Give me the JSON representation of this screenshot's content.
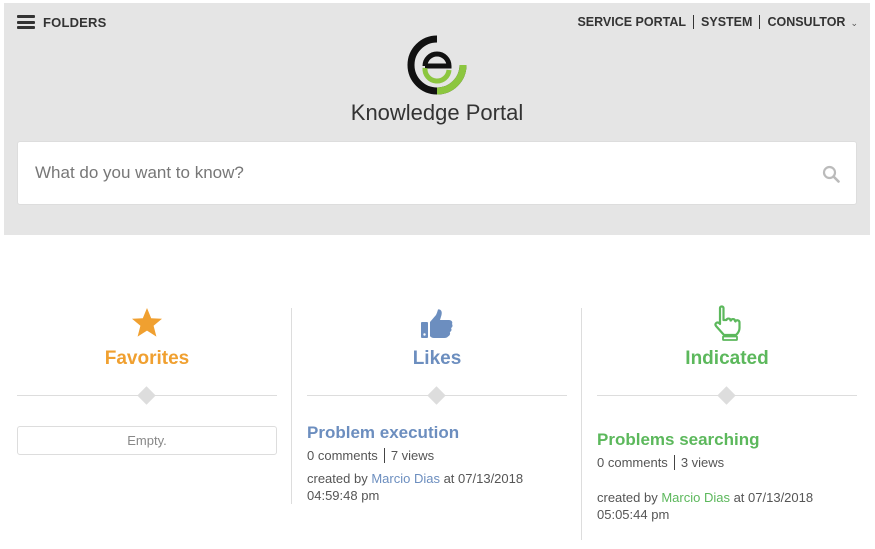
{
  "header": {
    "menu_label": "FOLDERS",
    "nav": {
      "service_portal": "SERVICE PORTAL",
      "system": "SYSTEM",
      "consultor": "CONSULTOR"
    },
    "title": "Knowledge Portal"
  },
  "search": {
    "placeholder": "What do you want to know?",
    "value": ""
  },
  "favorites": {
    "title": "Favorites",
    "icon": "star-icon",
    "color": "#f0a030",
    "empty_text": "Empty."
  },
  "likes": {
    "title": "Likes",
    "icon": "thumbs-up-icon",
    "color": "#6c8ebf",
    "items": [
      {
        "title": "Problem execution",
        "comments": "0 comments",
        "views": "7 views",
        "created_prefix": "created by",
        "author": "Marcio Dias",
        "created_suffix": "at 07/13/2018 04:59:48 pm"
      }
    ]
  },
  "indicated": {
    "title": "Indicated",
    "icon": "pointing-hand-icon",
    "color": "#5cb85c",
    "items": [
      {
        "title": "Problems searching",
        "comments": "0 comments",
        "views": "3 views",
        "created_prefix": "created by",
        "author": "Marcio Dias",
        "created_suffix": "at 07/13/2018 05:05:44 pm"
      }
    ]
  }
}
